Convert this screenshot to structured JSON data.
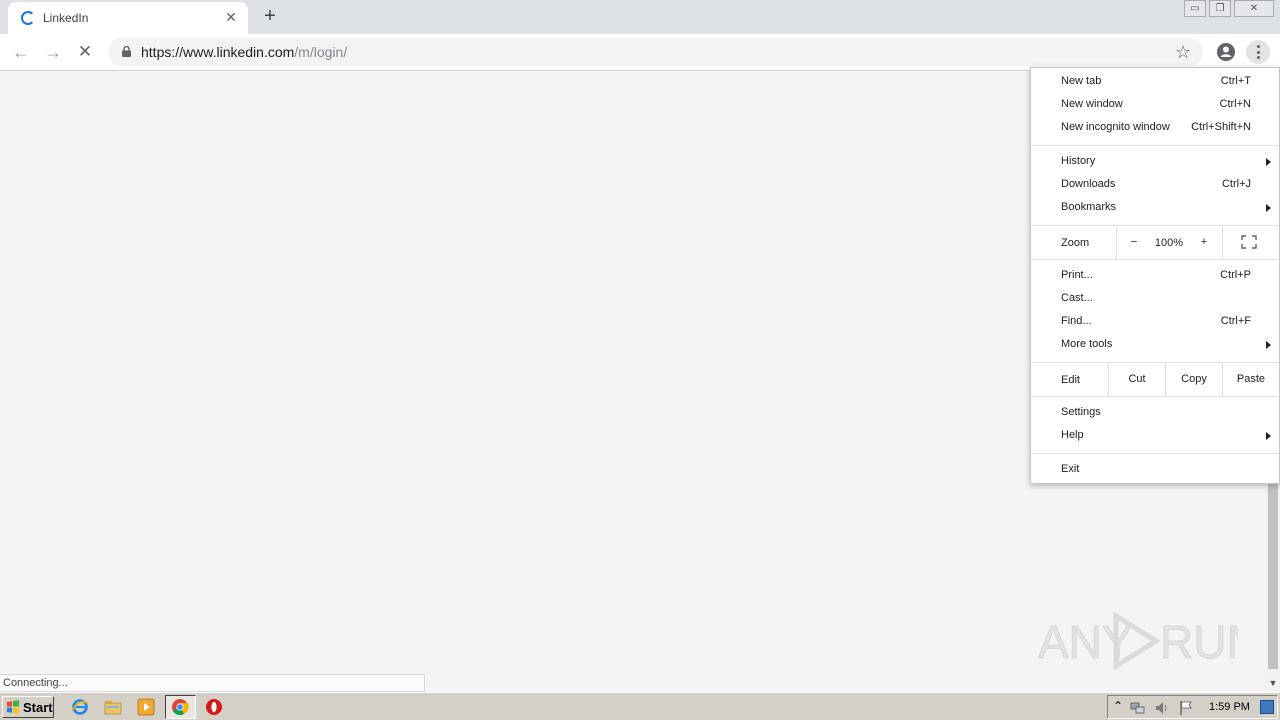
{
  "browser": {
    "tab": {
      "title": "LinkedIn",
      "close_glyph": "✕"
    },
    "new_tab_glyph": "+",
    "window_controls": {
      "minimize": "▭",
      "maximize": "❐",
      "close": "✕"
    },
    "nav": {
      "back": "←",
      "forward": "→",
      "stop": "✕"
    },
    "address": {
      "host": "https://www.linkedin.com",
      "path": "/m/login/"
    },
    "star_glyph": "☆"
  },
  "status_text": "Connecting...",
  "menu": {
    "group1": [
      {
        "label": "New tab",
        "shortcut": "Ctrl+T"
      },
      {
        "label": "New window",
        "shortcut": "Ctrl+N"
      },
      {
        "label": "New incognito window",
        "shortcut": "Ctrl+Shift+N"
      }
    ],
    "group2": [
      {
        "label": "History",
        "shortcut": ""
      },
      {
        "label": "Downloads",
        "shortcut": "Ctrl+J"
      },
      {
        "label": "Bookmarks",
        "shortcut": ""
      }
    ],
    "zoom": {
      "label": "Zoom",
      "minus": "−",
      "level": "100%",
      "plus": "+"
    },
    "group3": [
      {
        "label": "Print...",
        "shortcut": "Ctrl+P"
      },
      {
        "label": "Cast...",
        "shortcut": ""
      },
      {
        "label": "Find...",
        "shortcut": "Ctrl+F"
      },
      {
        "label": "More tools",
        "shortcut": ""
      }
    ],
    "edit": {
      "label": "Edit",
      "cut": "Cut",
      "copy": "Copy",
      "paste": "Paste"
    },
    "group4": [
      {
        "label": "Settings"
      },
      {
        "label": "Help"
      }
    ],
    "exit": "Exit"
  },
  "watermark": {
    "left": "ANY",
    "right": "RUN"
  },
  "taskbar": {
    "start_label": "Start",
    "clock": "1:59 PM"
  },
  "colors": {
    "accent": "#1a73e8",
    "menu_bg": "#ffffff",
    "page_bg": "#f4f4f4",
    "taskbar": "#d4d0c8"
  }
}
